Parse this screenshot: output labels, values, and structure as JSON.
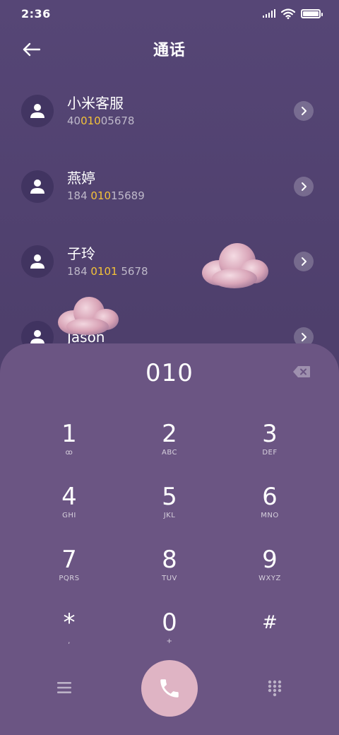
{
  "status_bar": {
    "time": "2:36",
    "icons": [
      "signal-icon",
      "wifi-icon",
      "battery-icon"
    ]
  },
  "header": {
    "title": "通话",
    "back_icon": "back-arrow-icon"
  },
  "contacts": [
    {
      "name": "小米客服",
      "number_parts": [
        "40",
        "010",
        "05678"
      ]
    },
    {
      "name": "燕婷",
      "number_parts": [
        "184 ",
        "010",
        "15689"
      ]
    },
    {
      "name": "子玲",
      "number_parts": [
        "184 ",
        "0101",
        " 5678"
      ]
    },
    {
      "name": "Jason",
      "number_parts": [
        "",
        "",
        ""
      ]
    }
  ],
  "dialpad": {
    "input": "010",
    "keys": [
      {
        "digit": "1",
        "letters": "ꝏ"
      },
      {
        "digit": "2",
        "letters": "ABC"
      },
      {
        "digit": "3",
        "letters": "DEF"
      },
      {
        "digit": "4",
        "letters": "GHI"
      },
      {
        "digit": "5",
        "letters": "JKL"
      },
      {
        "digit": "6",
        "letters": "MNO"
      },
      {
        "digit": "7",
        "letters": "PQRS"
      },
      {
        "digit": "8",
        "letters": "TUV"
      },
      {
        "digit": "9",
        "letters": "WXYZ"
      },
      {
        "digit": "*",
        "letters": ","
      },
      {
        "digit": "0",
        "letters": "+"
      },
      {
        "digit": "#",
        "letters": ""
      }
    ]
  },
  "colors": {
    "background": "#564676",
    "dialpad_panel": "#6b5583",
    "highlight": "#f5c338",
    "call_button": "#dfb4c4"
  }
}
